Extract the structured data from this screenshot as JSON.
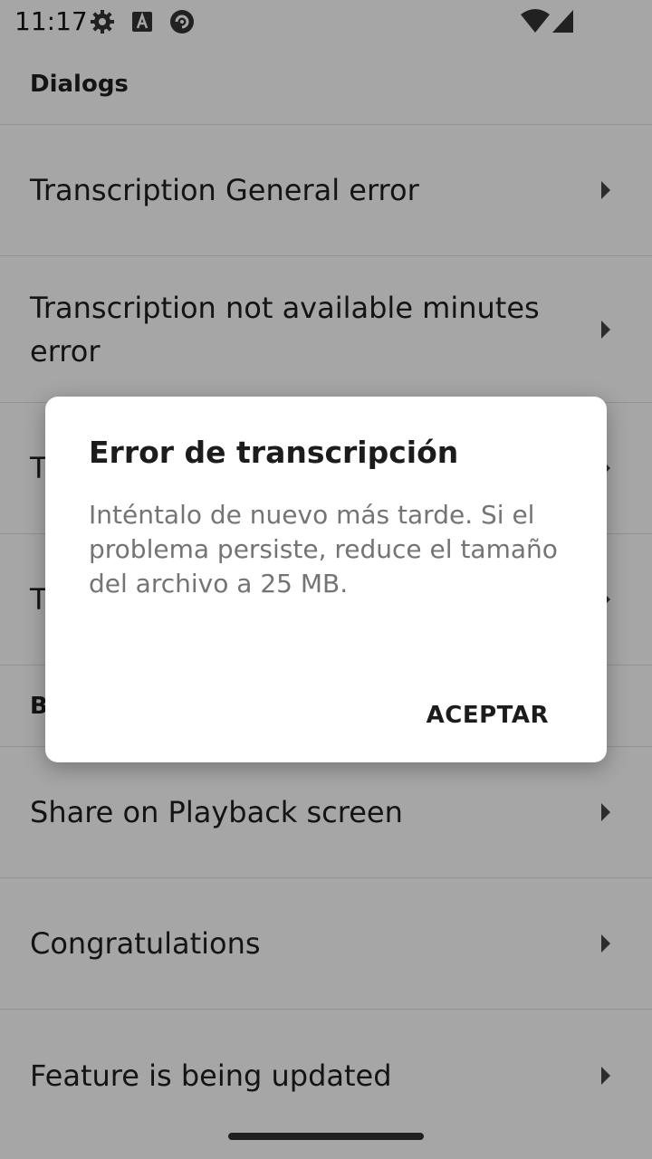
{
  "status": {
    "time": "11:17",
    "icons": [
      "gear-icon",
      "font-app-icon",
      "circle-app-icon",
      "wifi-icon",
      "signal-icon"
    ]
  },
  "list": {
    "section_dialogs": "Dialogs",
    "items": [
      {
        "label": "Transcription General error"
      },
      {
        "label": "Transcription not available minutes error"
      },
      {
        "label": "T"
      },
      {
        "label": "T"
      }
    ],
    "section_b": "B",
    "items2": [
      {
        "label": "Share on Playback screen"
      },
      {
        "label": "Congratulations"
      },
      {
        "label": "Feature is being updated"
      }
    ]
  },
  "dialog": {
    "title": "Error de transcripción",
    "message": "Inténtalo de nuevo más tarde. Si el problema persiste, reduce el tamaño del archivo a 25 MB.",
    "button": "ACEPTAR"
  },
  "colors": {
    "scrim": "#000000",
    "dialog_bg": "#ffffff",
    "message_text": "#747474"
  }
}
